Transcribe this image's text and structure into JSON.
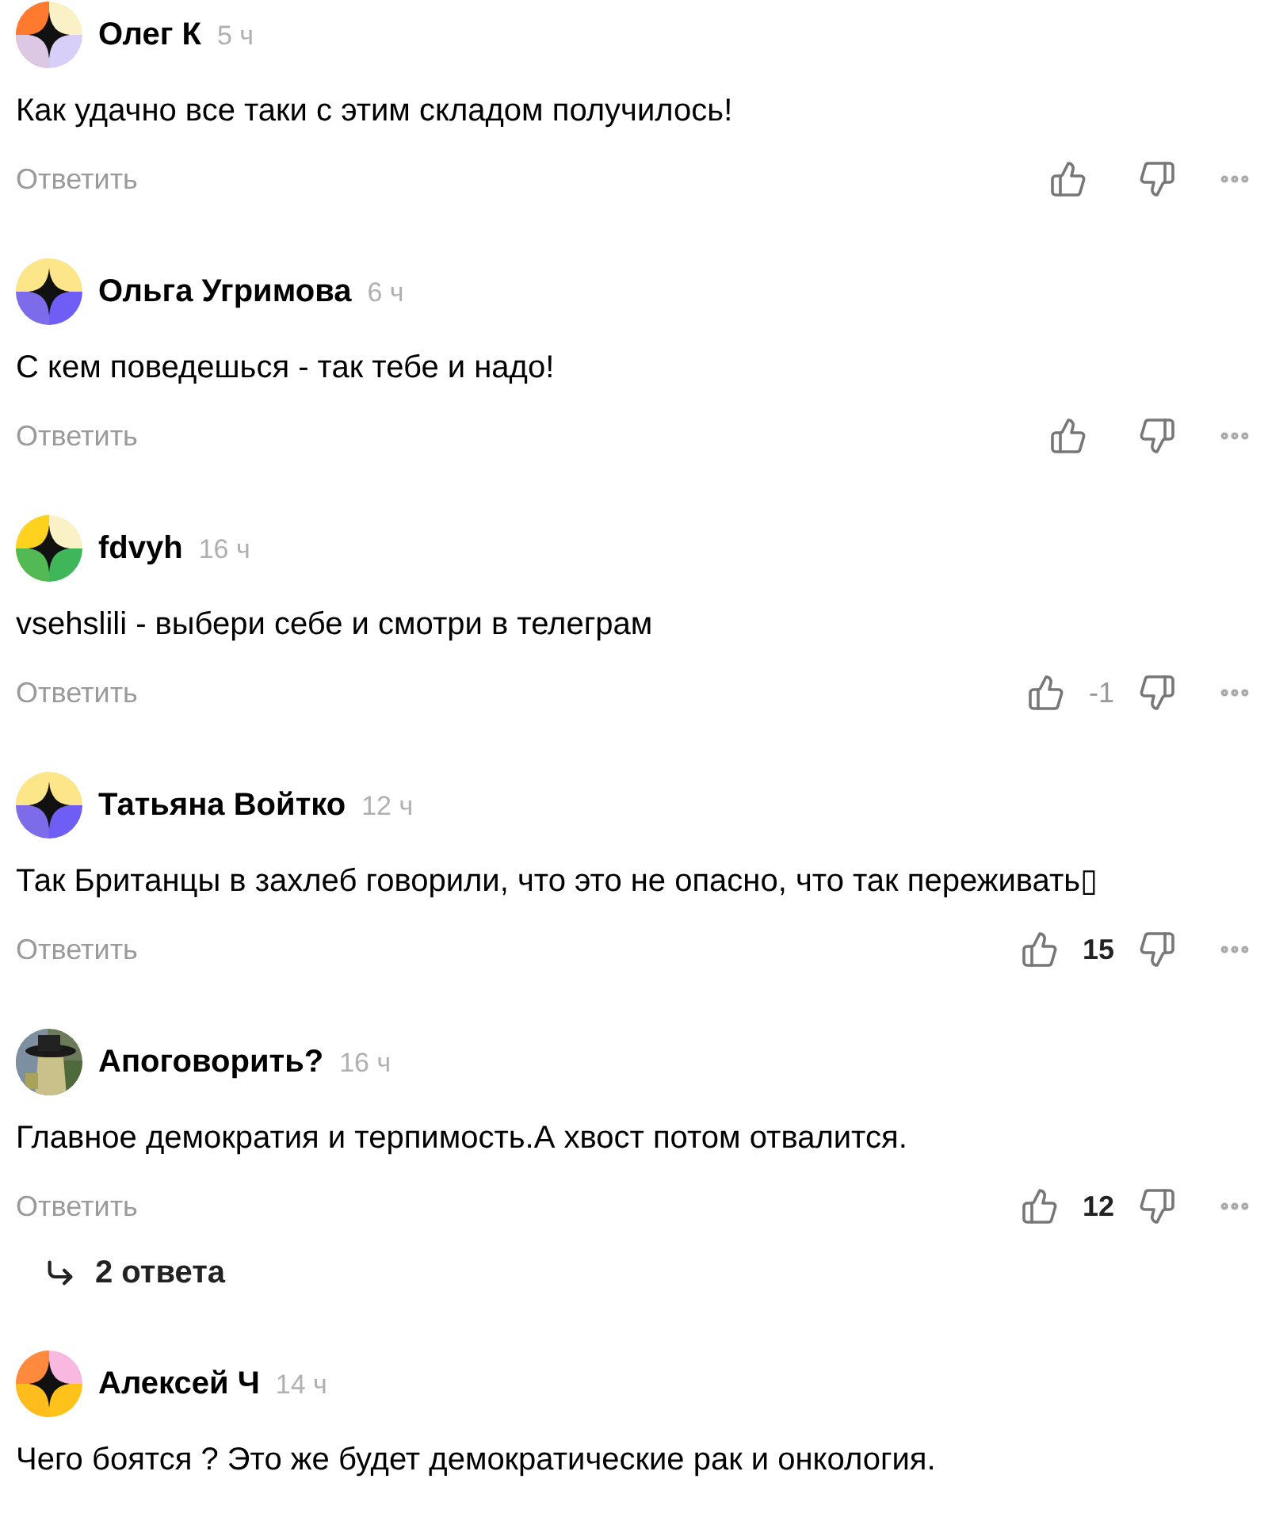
{
  "comments": [
    {
      "author": "Олег К",
      "time": "5 ч",
      "avatar": {
        "kind": "lilac"
      },
      "text": "Как удачно все таки с этим складом получилось!",
      "reply": "Ответить"
    },
    {
      "author": "Ольга Угримова",
      "time": "6 ч",
      "avatar": {
        "kind": "violet"
      },
      "text": "С кем поведешься - так тебе и надо!",
      "reply": "Ответить"
    },
    {
      "author": "fdvyh",
      "time": "16 ч",
      "avatar": {
        "kind": "green"
      },
      "text": "vsehslili - выбери себе и смотри в телеграм",
      "reply": "Ответить",
      "likes": "-1"
    },
    {
      "author": "Татьяна Войтко",
      "time": "12 ч",
      "avatar": {
        "kind": "violet"
      },
      "text": "Так Британцы в захлеб говорили, что это не опасно, что так переживать▯",
      "reply": "Ответить",
      "likes": "15"
    },
    {
      "author": "Апоговорить?",
      "time": "16 ч",
      "text": "Главное демократия и терпимость.А хвост потом отвалится.",
      "reply": "Ответить",
      "likes": "12",
      "replies": "2 ответа"
    },
    {
      "author": "Алексей Ч",
      "time": "14 ч",
      "avatar": {
        "kind": "pink"
      },
      "text": "Чего боятся ? Это же будет демократические рак и онкология."
    }
  ]
}
